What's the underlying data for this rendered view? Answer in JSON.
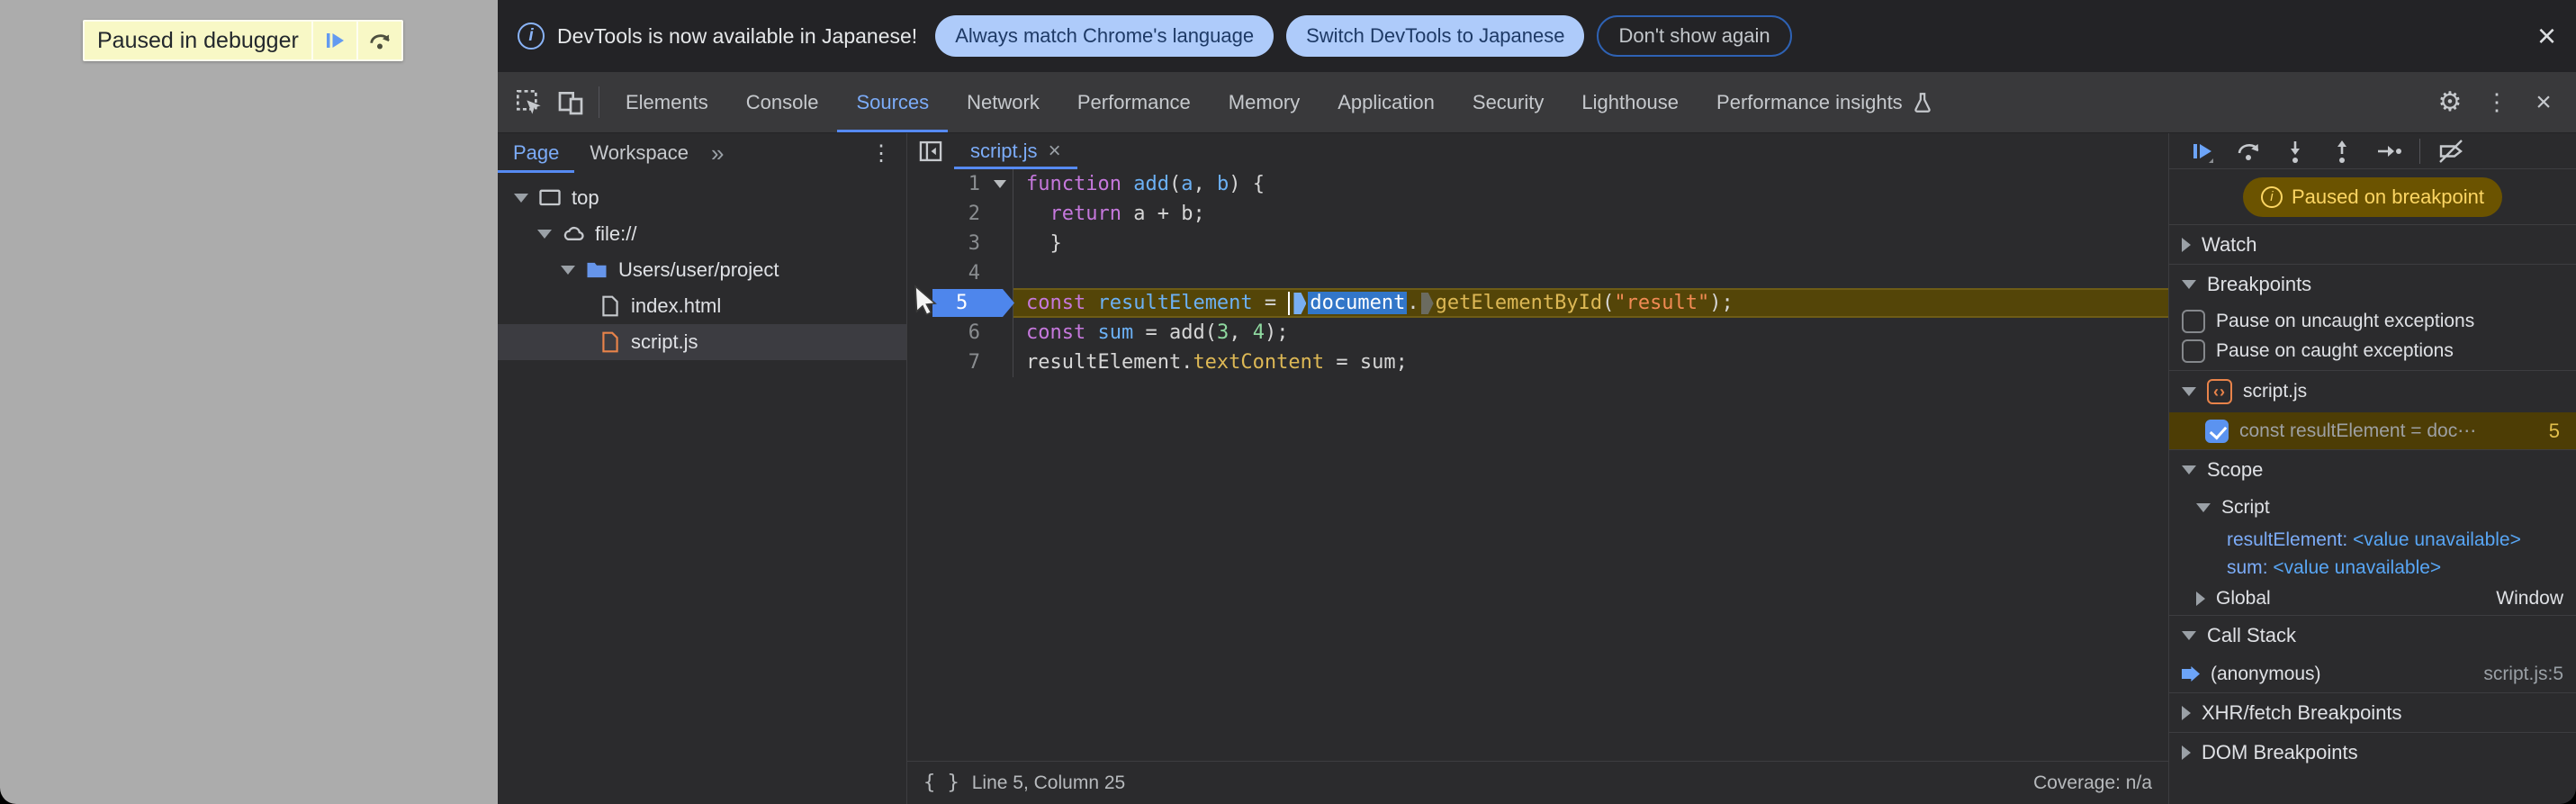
{
  "icons": {
    "close_glyph": "×",
    "kebab_glyph": "⋮",
    "gear_glyph": "⚙",
    "overflow_glyph": "»",
    "info_glyph": "i",
    "braces_glyph": "{ }",
    "tab_close_glyph": "×",
    "angle_brackets_glyph": "‹›"
  },
  "page": {
    "banner": {
      "label": "Paused in debugger"
    }
  },
  "infobar": {
    "message": "DevTools is now available in Japanese!",
    "primary_button": "Always match Chrome's language",
    "secondary_button": "Switch DevTools to Japanese",
    "dismiss_button": "Don't show again"
  },
  "panel_tabs": {
    "active": "Sources",
    "items": [
      {
        "label": "Elements"
      },
      {
        "label": "Console"
      },
      {
        "label": "Sources"
      },
      {
        "label": "Network"
      },
      {
        "label": "Performance"
      },
      {
        "label": "Memory"
      },
      {
        "label": "Application"
      },
      {
        "label": "Security"
      },
      {
        "label": "Lighthouse"
      },
      {
        "label": "Performance insights",
        "flask": true
      }
    ]
  },
  "navigator": {
    "page_tab": "Page",
    "workspace_tab": "Workspace",
    "tree": {
      "top": "top",
      "file_scheme": "file://",
      "folder": "Users/user/project",
      "index_file": "index.html",
      "script_file": "script.js"
    }
  },
  "editor": {
    "tab": "script.js",
    "code": {
      "lines": [
        {
          "num": 1,
          "fold": true,
          "tokens": [
            [
              "kw",
              "function"
            ],
            [
              "pl",
              " "
            ],
            [
              "def",
              "add"
            ],
            [
              "pl",
              "("
            ],
            [
              "def",
              "a"
            ],
            [
              "pl",
              ", "
            ],
            [
              "def",
              "b"
            ],
            [
              "pl",
              ") {"
            ]
          ]
        },
        {
          "num": 2,
          "tokens": [
            [
              "pl",
              "  "
            ],
            [
              "kw",
              "return"
            ],
            [
              "pl",
              " a + b;"
            ]
          ]
        },
        {
          "num": 3,
          "tokens": [
            [
              "pl",
              "  }"
            ]
          ]
        },
        {
          "num": 4,
          "tokens": []
        },
        {
          "num": 5,
          "exec": true,
          "tokens": [
            [
              "kw",
              "const"
            ],
            [
              "pl",
              " "
            ],
            [
              "def",
              "resultElement"
            ],
            [
              "pl",
              " = "
            ],
            [
              "caret",
              ""
            ],
            [
              "mark",
              "blue"
            ],
            [
              "docsel",
              "document"
            ],
            [
              "pl",
              "."
            ],
            [
              "mark",
              "gray"
            ],
            [
              "fn",
              "getElementById"
            ],
            [
              "pl",
              "("
            ],
            [
              "str",
              "\"result\""
            ],
            [
              "pl",
              ");"
            ]
          ]
        },
        {
          "num": 6,
          "tokens": [
            [
              "kw",
              "const"
            ],
            [
              "pl",
              " "
            ],
            [
              "def",
              "sum"
            ],
            [
              "pl",
              " = add("
            ],
            [
              "num",
              "3"
            ],
            [
              "pl",
              ", "
            ],
            [
              "num",
              "4"
            ],
            [
              "pl",
              ");"
            ]
          ]
        },
        {
          "num": 7,
          "tokens": [
            [
              "pl",
              "resultElement."
            ],
            [
              "fn",
              "textContent"
            ],
            [
              "pl",
              " = sum;"
            ]
          ]
        }
      ]
    },
    "status": {
      "position": "Line 5, Column 25",
      "coverage": "Coverage: n/a"
    }
  },
  "debugger": {
    "paused_badge": "Paused on breakpoint",
    "watch": "Watch",
    "breakpoints": {
      "title": "Breakpoints",
      "uncaught": "Pause on uncaught exceptions",
      "caught": "Pause on caught exceptions",
      "file": "script.js",
      "item": {
        "label": "const resultElement = doc⋯",
        "line": "5"
      }
    },
    "scope": {
      "title": "Scope",
      "script": "Script",
      "vars": [
        {
          "name": "resultElement",
          "sep": ": ",
          "value": "<value unavailable>"
        },
        {
          "name": "sum",
          "sep": ": ",
          "value": "<value unavailable>"
        }
      ],
      "global": "Global",
      "global_value": "Window"
    },
    "call_stack": {
      "title": "Call Stack",
      "frame": "(anonymous)",
      "location": "script.js:5"
    },
    "xhr": "XHR/fetch Breakpoints",
    "dom": "DOM Breakpoints"
  },
  "colors": {
    "accent_blue": "#7cacf8",
    "exec_line_bg": "#544508",
    "badge_bg": "#6b5300",
    "badge_text": "#fdd663",
    "keyword": "#c678dd",
    "definition": "#6cb1f5",
    "function": "#ddb855",
    "string": "#f28b54",
    "number": "#8fd9a0"
  }
}
